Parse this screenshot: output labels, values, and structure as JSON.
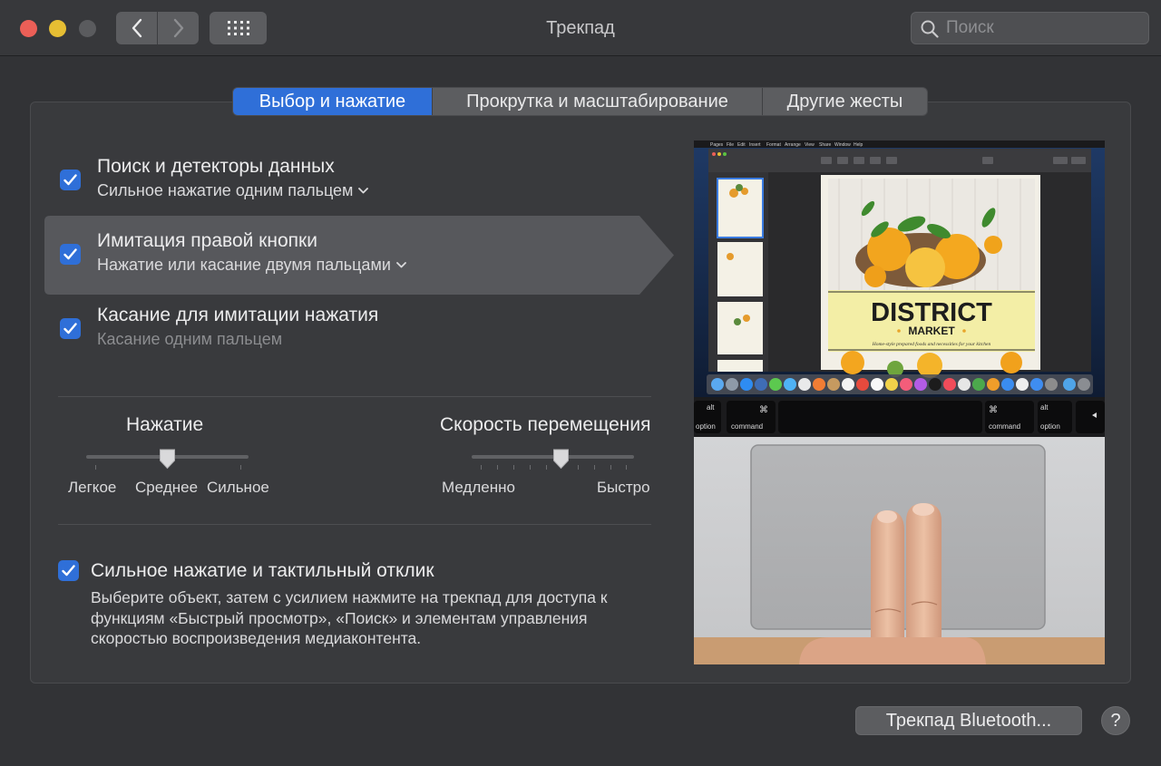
{
  "window": {
    "title": "Трекпад",
    "search_placeholder": "Поиск"
  },
  "tabs": [
    {
      "label": "Выбор и нажатие",
      "active": true
    },
    {
      "label": "Прокрутка и масштабирование",
      "active": false
    },
    {
      "label": "Другие жесты",
      "active": false
    }
  ],
  "options": [
    {
      "title": "Поиск и детекторы данных",
      "subtitle": "Сильное нажатие одним пальцем",
      "checked": true,
      "has_menu": true,
      "highlighted": false
    },
    {
      "title": "Имитация правой кнопки",
      "subtitle": "Нажатие или касание двумя пальцами",
      "checked": true,
      "has_menu": true,
      "highlighted": true
    },
    {
      "title": "Касание для имитации нажатия",
      "subtitle": "Касание одним пальцем",
      "checked": true,
      "has_menu": false,
      "highlighted": false
    }
  ],
  "click_slider": {
    "title": "Нажатие",
    "labels": [
      "Легкое",
      "Среднее",
      "Сильное"
    ],
    "value_index": 1,
    "positions": 3
  },
  "speed_slider": {
    "title": "Скорость перемещения",
    "min_label": "Медленно",
    "max_label": "Быстро",
    "value_index": 5,
    "positions": 10
  },
  "force_click": {
    "title": "Сильное нажатие и тактильный отклик",
    "checked": true,
    "description": "Выберите объект, затем с усилием нажмите на трекпад для доступа к функциям «Быстрый просмотр», «Поиск» и элементам управления скоростью воспроизведения медиаконтента."
  },
  "preview": {
    "doc_title_1": "DISTRICT",
    "doc_title_2": "MARKET",
    "doc_tagline": "Home-style prepared foods and necessities for your kitchen",
    "key_labels": {
      "option": "option",
      "command": "command",
      "alt": "alt",
      "cmd_symbol": "⌘"
    }
  },
  "footer": {
    "bluetooth_button": "Трекпад Bluetooth...",
    "help_button": "?"
  },
  "colors": {
    "accent": "#2f6fd8",
    "background": "#323336"
  }
}
